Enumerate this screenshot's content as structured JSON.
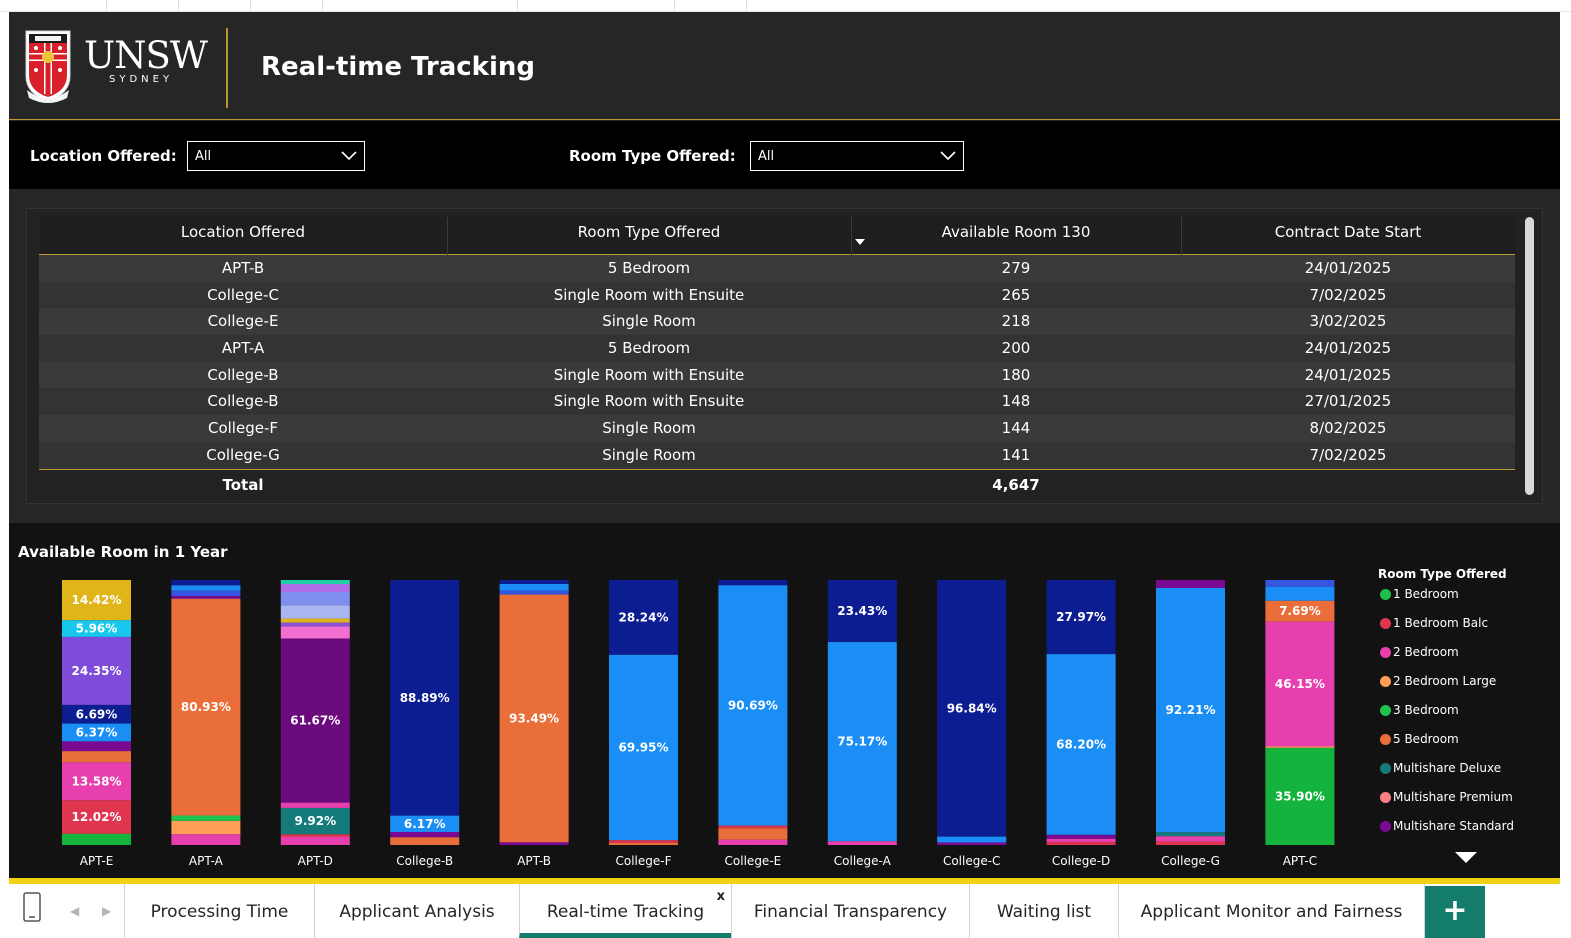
{
  "header": {
    "logo_wordmark": "UNSW",
    "logo_subtitle": "SYDNEY",
    "title": "Real-time Tracking"
  },
  "filters": {
    "location": {
      "label": "Location Offered:",
      "value": "All",
      "icon": "chevron-down-icon"
    },
    "room_type": {
      "label": "Room Type Offered:",
      "value": "All",
      "icon": "chevron-down-icon"
    }
  },
  "table": {
    "columns": [
      "Location Offered",
      "Room Type Offered",
      "Available Room 130",
      "Contract Date Start"
    ],
    "sorted_column": "Available Room 130",
    "rows": [
      [
        "APT-B",
        "5 Bedroom",
        "279",
        "24/01/2025"
      ],
      [
        "College-C",
        "Single Room with Ensuite",
        "265",
        "7/02/2025"
      ],
      [
        "College-E",
        "Single Room",
        "218",
        "3/02/2025"
      ],
      [
        "APT-A",
        "5 Bedroom",
        "200",
        "24/01/2025"
      ],
      [
        "College-B",
        "Single Room with Ensuite",
        "180",
        "24/01/2025"
      ],
      [
        "College-B",
        "Single Room with Ensuite",
        "148",
        "27/01/2025"
      ],
      [
        "College-F",
        "Single Room",
        "144",
        "8/02/2025"
      ],
      [
        "College-G",
        "Single Room",
        "141",
        "7/02/2025"
      ]
    ],
    "total_label": "Total",
    "total_value": "4,647"
  },
  "chart_data": {
    "type": "bar",
    "stacked": "100%",
    "title": "Available Room in 1 Year",
    "legend_title": "Room Type Offered",
    "categories": [
      "APT-E",
      "APT-A",
      "APT-D",
      "College-B",
      "APT-B",
      "College-F",
      "College-E",
      "College-A",
      "College-C",
      "College-D",
      "College-G",
      "APT-C"
    ],
    "legend": [
      {
        "name": "1 Bedroom",
        "color": "#1dbf4a"
      },
      {
        "name": "1 Bedroom Balc",
        "color": "#e0354f"
      },
      {
        "name": "2 Bedroom",
        "color": "#e83fae"
      },
      {
        "name": "2 Bedroom Large",
        "color": "#ff9f57"
      },
      {
        "name": "3 Bedroom",
        "color": "#1fc24d"
      },
      {
        "name": "5 Bedroom",
        "color": "#ea6e3a"
      },
      {
        "name": "Multishare Deluxe",
        "color": "#157a7a"
      },
      {
        "name": "Multishare Premium",
        "color": "#ff7f86"
      },
      {
        "name": "Multishare Standard",
        "color": "#7a0a94"
      }
    ],
    "bars": [
      {
        "category": "APT-E",
        "segments": [
          {
            "color": "#e0b51a",
            "value": 14.42,
            "label": "14.42%"
          },
          {
            "color": "#18c7ee",
            "value": 5.96,
            "label": "5.96%"
          },
          {
            "color": "#7f4bd9",
            "value": 24.35,
            "label": "24.35%"
          },
          {
            "color": "#0c1d91",
            "value": 6.69,
            "label": "6.69%"
          },
          {
            "color": "#1a8ef5",
            "value": 6.37,
            "label": "6.37%"
          },
          {
            "color": "#7a0a94",
            "value": 3.5,
            "label": ""
          },
          {
            "color": "#ea6e3a",
            "value": 4.0,
            "label": ""
          },
          {
            "color": "#e83fae",
            "value": 13.58,
            "label": "13.58%"
          },
          {
            "color": "#e0354f",
            "value": 12.02,
            "label": "12.02%"
          },
          {
            "color": "#14b33e",
            "value": 4.0,
            "label": ""
          }
        ]
      },
      {
        "category": "APT-A",
        "segments": [
          {
            "color": "#0c1d91",
            "value": 2.0,
            "label": ""
          },
          {
            "color": "#1a8ef5",
            "value": 2.0,
            "label": ""
          },
          {
            "color": "#3556e0",
            "value": 2.0,
            "label": ""
          },
          {
            "color": "#7a0a94",
            "value": 1.0,
            "label": ""
          },
          {
            "color": "#ea6e3a",
            "value": 80.93,
            "label": "80.93%"
          },
          {
            "color": "#1fc24d",
            "value": 2.0,
            "label": ""
          },
          {
            "color": "#ff9f57",
            "value": 5.0,
            "label": ""
          },
          {
            "color": "#e83fae",
            "value": 4.0,
            "label": ""
          }
        ]
      },
      {
        "category": "APT-D",
        "segments": [
          {
            "color": "#1fd1a5",
            "value": 1.5,
            "label": ""
          },
          {
            "color": "#b06fe6",
            "value": 3.0,
            "label": ""
          },
          {
            "color": "#7f8ff0",
            "value": 5.0,
            "label": ""
          },
          {
            "color": "#a9b6f2",
            "value": 5.0,
            "label": ""
          },
          {
            "color": "#e0b51a",
            "value": 1.5,
            "label": ""
          },
          {
            "color": "#8c52d4",
            "value": 1.5,
            "label": ""
          },
          {
            "color": "#f06fd1",
            "value": 4.5,
            "label": ""
          },
          {
            "color": "#6a0a7d",
            "value": 61.67,
            "label": "61.67%"
          },
          {
            "color": "#e83fae",
            "value": 2.0,
            "label": ""
          },
          {
            "color": "#157a7a",
            "value": 9.92,
            "label": "9.92%"
          },
          {
            "color": "#e0354f",
            "value": 1.0,
            "label": ""
          },
          {
            "color": "#e83fae",
            "value": 3.0,
            "label": ""
          }
        ]
      },
      {
        "category": "College-B",
        "segments": [
          {
            "color": "#0c1d91",
            "value": 88.89,
            "label": "88.89%"
          },
          {
            "color": "#1a8ef5",
            "value": 6.17,
            "label": "6.17%"
          },
          {
            "color": "#7a0a94",
            "value": 2.0,
            "label": ""
          },
          {
            "color": "#ea6e3a",
            "value": 2.9,
            "label": ""
          }
        ]
      },
      {
        "category": "APT-B",
        "segments": [
          {
            "color": "#0c1d91",
            "value": 1.5,
            "label": ""
          },
          {
            "color": "#1a8ef5",
            "value": 2.5,
            "label": ""
          },
          {
            "color": "#3556e0",
            "value": 1.5,
            "label": ""
          },
          {
            "color": "#ea6e3a",
            "value": 93.49,
            "label": "93.49%"
          },
          {
            "color": "#7a0a94",
            "value": 1.0,
            "label": ""
          }
        ]
      },
      {
        "category": "College-F",
        "segments": [
          {
            "color": "#0c1d91",
            "value": 28.24,
            "label": "28.24%"
          },
          {
            "color": "#1a8ef5",
            "value": 69.95,
            "label": "69.95%"
          },
          {
            "color": "#e0354f",
            "value": 1.0,
            "label": ""
          },
          {
            "color": "#ea6e3a",
            "value": 0.8,
            "label": ""
          }
        ]
      },
      {
        "category": "College-E",
        "segments": [
          {
            "color": "#0c1d91",
            "value": 2.0,
            "label": ""
          },
          {
            "color": "#1a8ef5",
            "value": 90.69,
            "label": "90.69%"
          },
          {
            "color": "#e0354f",
            "value": 1.0,
            "label": ""
          },
          {
            "color": "#ea6e3a",
            "value": 4.3,
            "label": ""
          },
          {
            "color": "#e83fae",
            "value": 2.0,
            "label": ""
          }
        ]
      },
      {
        "category": "College-A",
        "segments": [
          {
            "color": "#0c1d91",
            "value": 23.43,
            "label": "23.43%"
          },
          {
            "color": "#1a8ef5",
            "value": 75.17,
            "label": "75.17%"
          },
          {
            "color": "#e83fae",
            "value": 1.4,
            "label": ""
          }
        ]
      },
      {
        "category": "College-C",
        "segments": [
          {
            "color": "#0c1d91",
            "value": 96.84,
            "label": "96.84%"
          },
          {
            "color": "#1a8ef5",
            "value": 2.2,
            "label": ""
          },
          {
            "color": "#7a0a94",
            "value": 0.96,
            "label": ""
          }
        ]
      },
      {
        "category": "College-D",
        "segments": [
          {
            "color": "#0c1d91",
            "value": 27.97,
            "label": "27.97%"
          },
          {
            "color": "#1a8ef5",
            "value": 68.2,
            "label": "68.20%"
          },
          {
            "color": "#7a0a94",
            "value": 1.5,
            "label": ""
          },
          {
            "color": "#e83fae",
            "value": 1.3,
            "label": ""
          },
          {
            "color": "#e0354f",
            "value": 1.03,
            "label": ""
          }
        ]
      },
      {
        "category": "College-G",
        "segments": [
          {
            "color": "#7a0a94",
            "value": 3.0,
            "label": ""
          },
          {
            "color": "#1a8ef5",
            "value": 92.21,
            "label": "92.21%"
          },
          {
            "color": "#157a7a",
            "value": 1.5,
            "label": ""
          },
          {
            "color": "#e83fae",
            "value": 2.0,
            "label": ""
          },
          {
            "color": "#e0354f",
            "value": 1.29,
            "label": ""
          }
        ]
      },
      {
        "category": "APT-C",
        "segments": [
          {
            "color": "#3556e0",
            "value": 2.56,
            "label": ""
          },
          {
            "color": "#1a8ef5",
            "value": 5.13,
            "label": ""
          },
          {
            "color": "#ea6e3a",
            "value": 7.69,
            "label": "7.69%"
          },
          {
            "color": "#e83fae",
            "value": 46.15,
            "label": "46.15%"
          },
          {
            "color": "#ff9f57",
            "value": 0.5,
            "label": ""
          },
          {
            "color": "#14b33e",
            "value": 35.9,
            "label": "35.90%"
          }
        ]
      }
    ]
  },
  "tabs": [
    {
      "label": "Processing Time"
    },
    {
      "label": "Applicant Analysis"
    },
    {
      "label": "Real-time Tracking",
      "active": true,
      "close_glyph": "x"
    },
    {
      "label": "Financial Transparency"
    },
    {
      "label": "Waiting list"
    },
    {
      "label": "Applicant Monitor and Fairness"
    }
  ],
  "tabbar": {
    "add_glyph": "+",
    "prev_glyph": "◀",
    "next_glyph": "▶",
    "device_icon": "phone-icon"
  },
  "colors": {
    "accent_gold": "#b99a2e",
    "tab_accent": "#137c6b",
    "status_band": "#f2d214"
  }
}
